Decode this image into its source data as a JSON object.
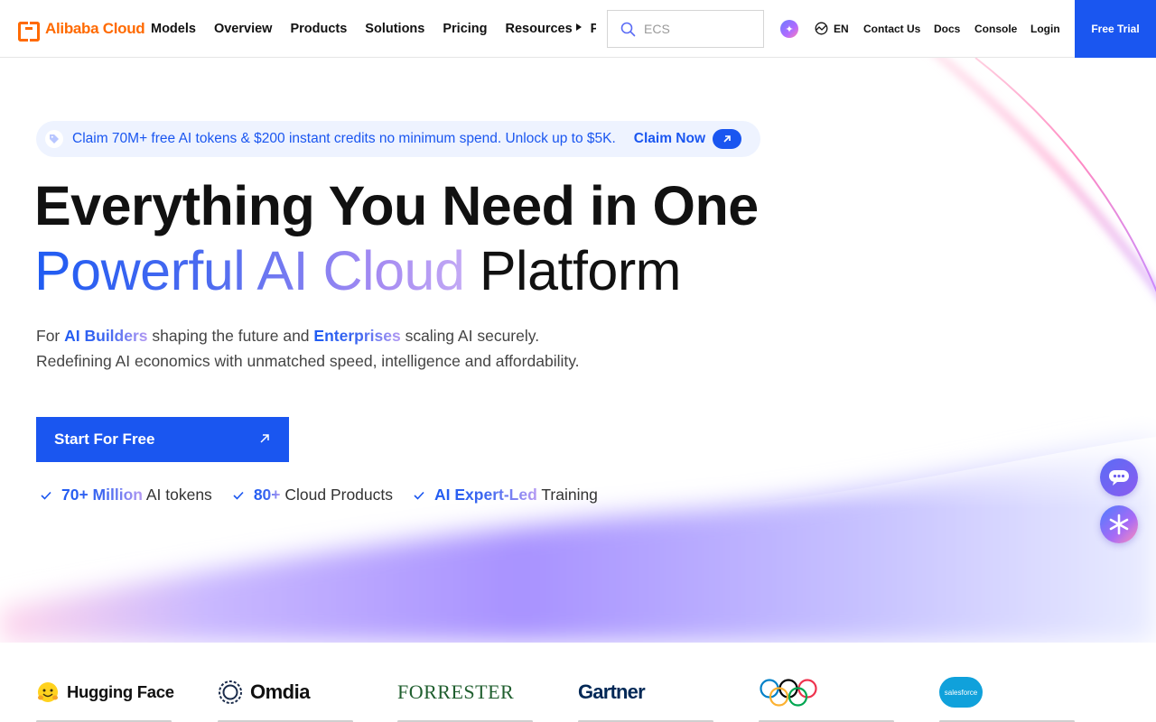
{
  "brand": {
    "logo_text": "Alibaba Cloud",
    "accent": "#ff6a00",
    "primary": "#1a56f0"
  },
  "nav": {
    "items": [
      "Models",
      "Overview",
      "Products",
      "Solutions",
      "Pricing",
      "Resources",
      "Partners"
    ],
    "more_icon": "chevron-right-icon",
    "search_placeholder": "ECS",
    "language": "EN",
    "contact": "Contact Us",
    "docs": "Docs",
    "console": "Console",
    "login": "Login",
    "free_trial": "Free Trial"
  },
  "promo": {
    "icon": "tag-icon",
    "text": "Claim 70M+ free AI tokens & $200 instant credits no minimum spend. Unlock up to $5K.",
    "cta": "Claim Now"
  },
  "hero": {
    "title_line1": "Everything You Need in One",
    "title_line2_highlight": "Powerful AI Cloud",
    "title_line2_rest": "Platform",
    "sub1_pre": "For ",
    "sub1_hl1": "AI Builders",
    "sub1_mid": " shaping the future and ",
    "sub1_hl2": "Enterprises",
    "sub1_post": " scaling AI securely.",
    "sub2": "Redefining AI economics with unmatched speed, intelligence and affordability.",
    "cta": "Start For Free"
  },
  "highlights": [
    {
      "strong": "70+ Million",
      "rest": " AI tokens"
    },
    {
      "strong": "80+",
      "rest": " Cloud Products"
    },
    {
      "strong": "AI Expert-Led",
      "rest": " Training"
    }
  ],
  "partners": {
    "hugging_face": "Hugging Face",
    "omdia": "Omdia",
    "forrester": "FORRESTER",
    "gartner": "Gartner",
    "salesforce": "salesforce"
  },
  "floating": {
    "chat_icon": "chat-bubble-icon",
    "ai_icon": "ai-spark-icon"
  }
}
